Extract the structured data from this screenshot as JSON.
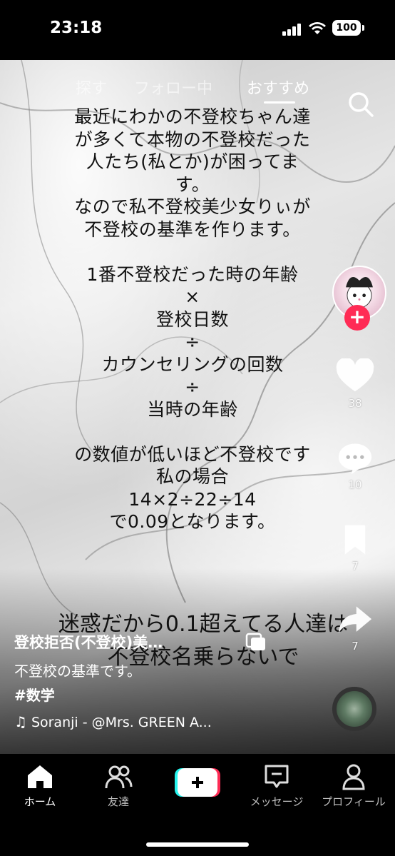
{
  "status_bar": {
    "time": "23:18",
    "battery": "100"
  },
  "top_tabs": [
    {
      "label": "探す"
    },
    {
      "label": "フォロー中"
    },
    {
      "label": "おすすめ"
    }
  ],
  "overlay_text": "最近にわかの不登校ちゃん達\nが多くて本物の不登校だった\n人たち(私とか)が困ってま\nす。\nなので私不登校美少女りぃが\n不登校の基準を作ります。\n\n1番不登校だった時の年齢\n×\n登校日数\n÷\nカウンセリングの回数\n÷\n当時の年齢\n\nの数値が低いほど不登校です\n私の場合\n14×2÷22÷14\nで0.09となります。",
  "overlay_caption": "迷惑だから0.1超えてる人達は\n不登校名乗らないで",
  "rail": {
    "likes": "38",
    "comments": "10",
    "saves": "7",
    "shares": "7"
  },
  "video_info": {
    "title": "登校拒否(不登校)美…",
    "description": "不登校の基準です。",
    "hashtag": "#数学",
    "music": "Soranji - @Mrs. GREEN A..."
  },
  "bottom_nav": [
    {
      "label": "ホーム"
    },
    {
      "label": "友達"
    },
    {
      "label": "メッセージ"
    },
    {
      "label": "プロフィール"
    }
  ],
  "colors": {
    "accent": "#ff2b55",
    "create_left": "#25f4ee",
    "create_right": "#fe2c55"
  }
}
